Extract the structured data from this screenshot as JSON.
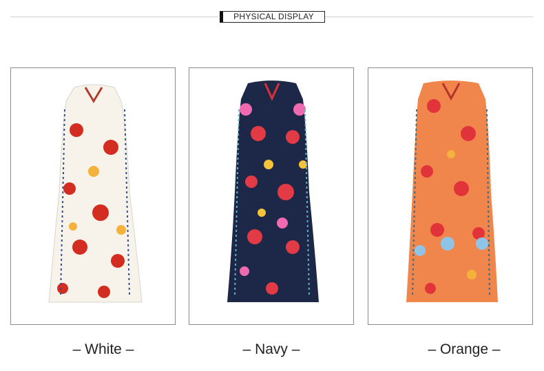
{
  "header": {
    "title": "PHYSICAL DISPLAY"
  },
  "products": [
    {
      "label": "White",
      "dress_color": "#f7f3ea",
      "accent": "#d32d22"
    },
    {
      "label": "Navy",
      "dress_color": "#1d2748",
      "accent": "#e23b45"
    },
    {
      "label": "Orange",
      "dress_color": "#f1864c",
      "accent": "#e0343a"
    }
  ],
  "label_dash": "–"
}
